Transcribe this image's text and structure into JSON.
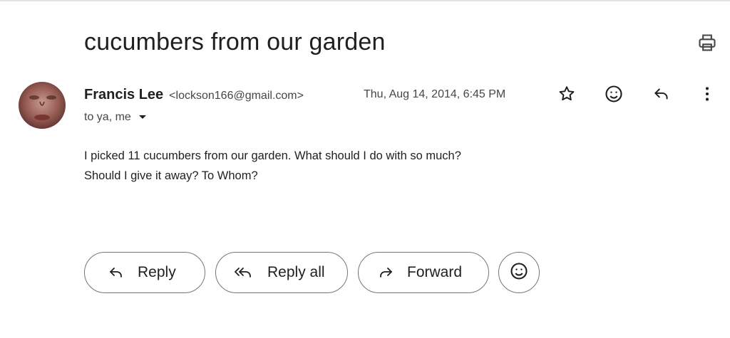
{
  "email": {
    "subject": "cucumbers from our garden",
    "sender_name": "Francis Lee",
    "sender_email": "<lockson166@gmail.com>",
    "date": "Thu, Aug 14, 2014, 6:45 PM",
    "recipients": "to ya, me",
    "body_lines": [
      "I picked 11 cucumbers from our garden. What should I do with so much?",
      "Should I give it away? To Whom?"
    ]
  },
  "actions": {
    "reply_label": "Reply",
    "reply_all_label": "Reply all",
    "forward_label": "Forward"
  },
  "icons": {
    "print": "print-icon",
    "star": "star-icon",
    "emoji": "emoji-icon",
    "reply": "reply-icon",
    "more": "more-vert-icon",
    "expand": "chevron-down-icon",
    "reply_all": "reply-all-icon",
    "forward": "forward-icon"
  },
  "colors": {
    "text": "#1f1f1f",
    "secondary_text": "#444746",
    "outline": "#747775"
  }
}
